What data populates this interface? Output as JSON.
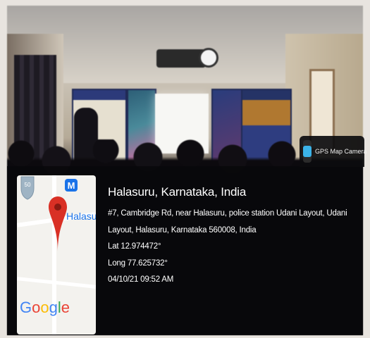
{
  "app_badge": {
    "label": "GPS Map Camera",
    "icon": "gps-map-camera-app-icon"
  },
  "map": {
    "place_label": "Halasu",
    "metro_letter": "M",
    "logo_text": "Google",
    "logo_colors": [
      "#4285F4",
      "#EA4335",
      "#FBBC05",
      "#4285F4",
      "#34A853",
      "#EA4335"
    ],
    "pin_color": "#d93025"
  },
  "location": {
    "title": "Halasuru, Karnataka, India",
    "address_line1": "#7, Cambridge Rd, near Halasuru, police station Udani Layout, Udani",
    "address_line2": "Layout, Halasuru, Karnataka 560008, India",
    "lat": "Lat 12.974472°",
    "long": "Long 77.625732°",
    "timestamp": "04/10/21 09:52 AM"
  }
}
